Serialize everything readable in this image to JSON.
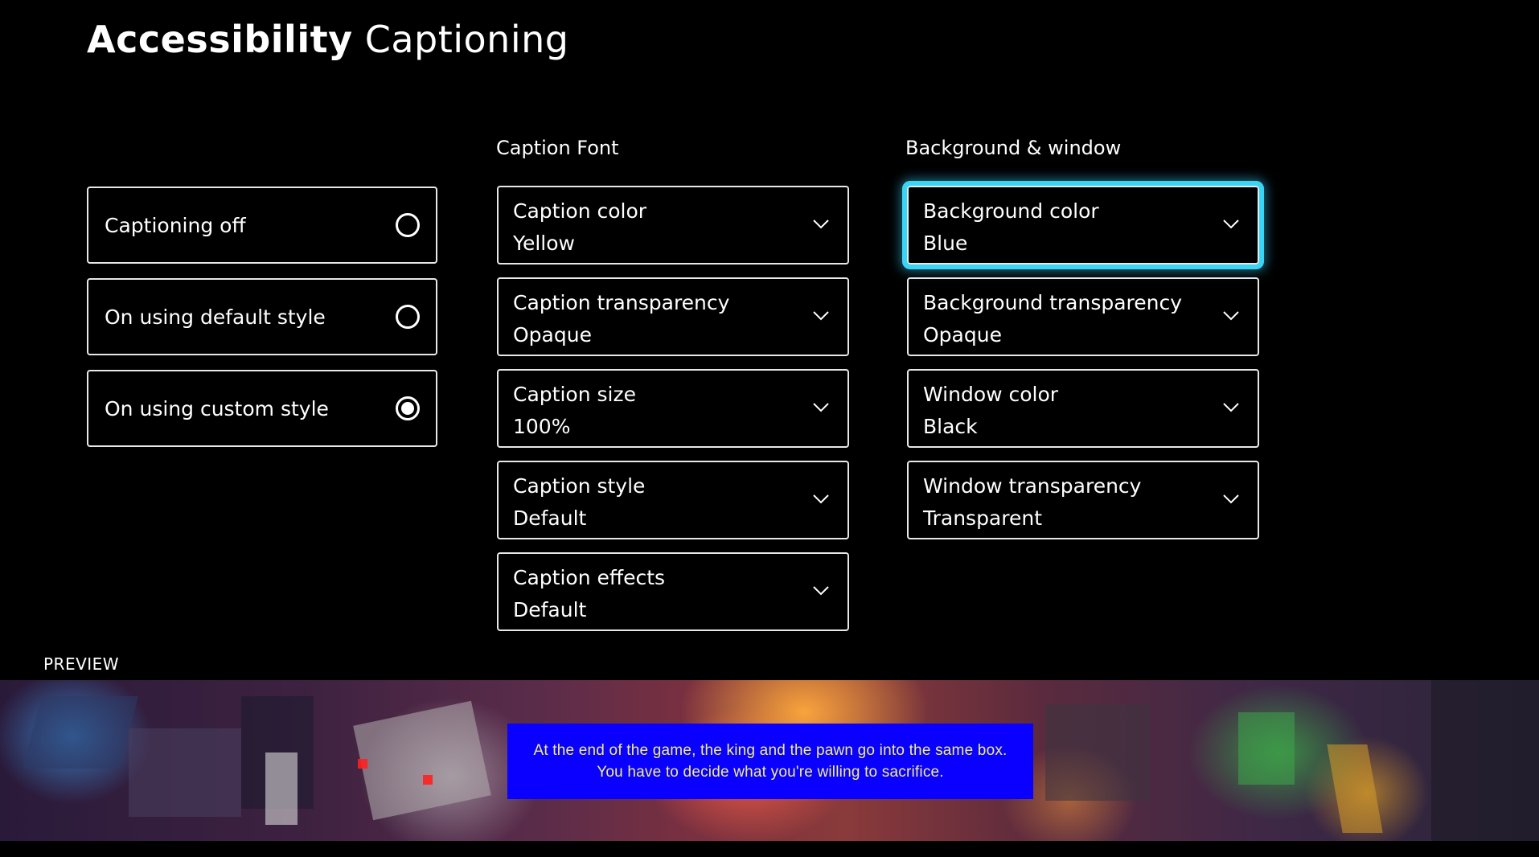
{
  "header": {
    "title_bold": "Accessibility",
    "title_light": "Captioning"
  },
  "captioning_modes": {
    "items": [
      {
        "label": "Captioning off",
        "selected": false
      },
      {
        "label": "On using default style",
        "selected": false
      },
      {
        "label": "On using custom style",
        "selected": true
      }
    ]
  },
  "caption_font": {
    "header": "Caption Font",
    "dropdowns": [
      {
        "label": "Caption color",
        "value": "Yellow"
      },
      {
        "label": "Caption transparency",
        "value": "Opaque"
      },
      {
        "label": "Caption size",
        "value": "100%"
      },
      {
        "label": "Caption style",
        "value": "Default"
      },
      {
        "label": "Caption effects",
        "value": "Default"
      }
    ]
  },
  "background_window": {
    "header": "Background & window",
    "focused_index": 0,
    "dropdowns": [
      {
        "label": "Background color",
        "value": "Blue"
      },
      {
        "label": "Background transparency",
        "value": "Opaque"
      },
      {
        "label": "Window color",
        "value": "Black"
      },
      {
        "label": "Window transparency",
        "value": "Transparent"
      }
    ]
  },
  "preview": {
    "label": "PREVIEW",
    "caption_lines": [
      "At the end of the game, the king and the pawn go into the same box.",
      "You have to decide what you're willing to sacrifice."
    ],
    "caption_text_color": "#f0ee7a",
    "caption_background_color": "#0a00ff"
  },
  "colors": {
    "focus_accent": "#39d5f5",
    "background": "#000000",
    "border": "#e8e8e8"
  },
  "icons": {
    "dropdown_chevron": "chevron-down-icon",
    "radio_unselected": "radio-unchecked-icon",
    "radio_selected": "radio-checked-icon"
  }
}
